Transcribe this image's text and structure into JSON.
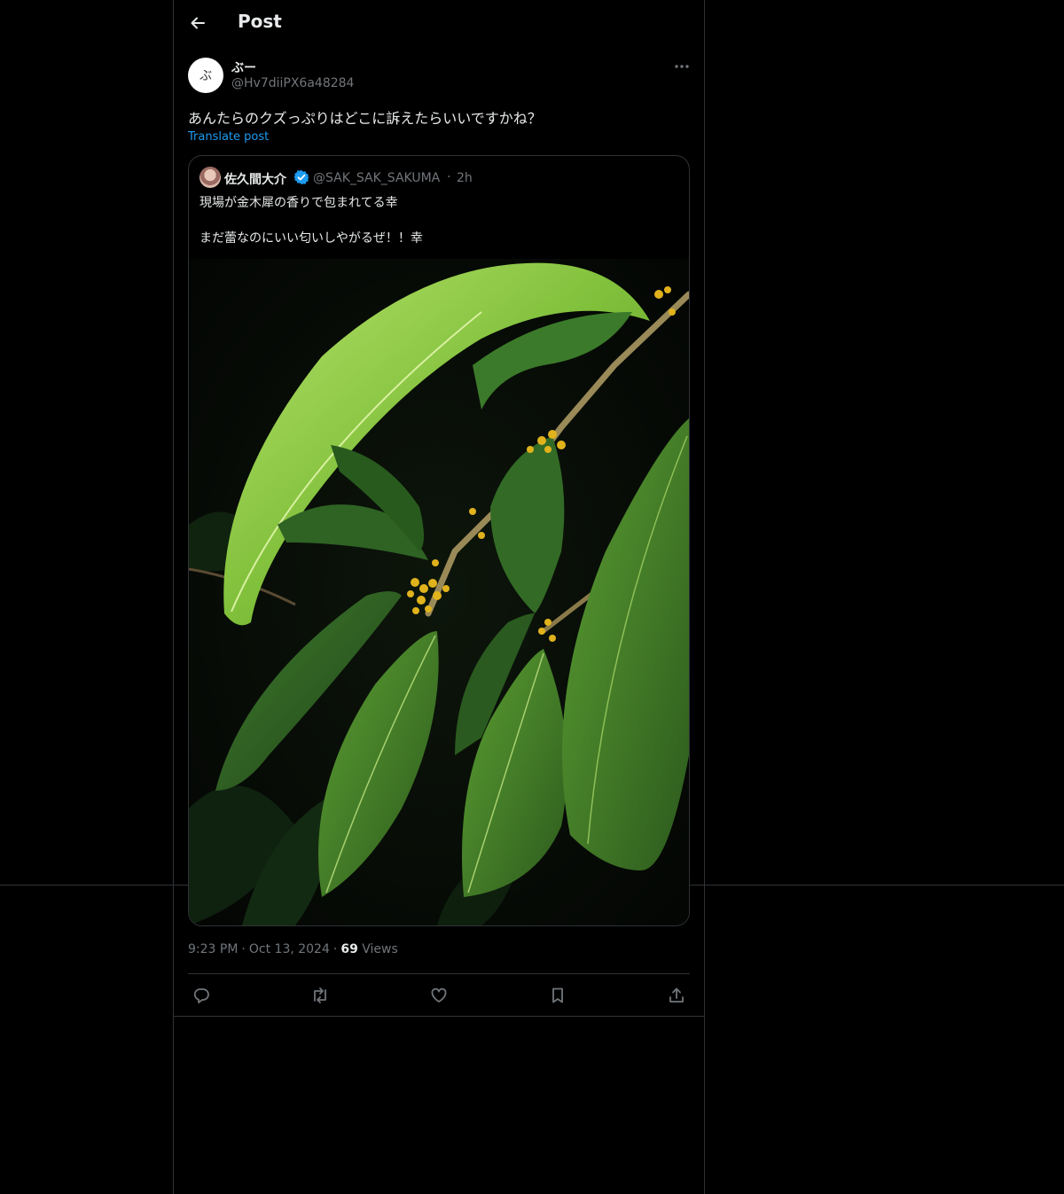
{
  "header": {
    "title": "Post"
  },
  "post": {
    "author_name": "ぶー",
    "author_handle": "@Hv7diiPX6a48284",
    "avatar_text": "ぶ",
    "text": "あんたらのクズっぷりはどこに訴えたらいいですかね？",
    "translate_label": "Translate post",
    "time": "9:23 PM",
    "date": "Oct 13, 2024",
    "views_count": "69",
    "views_label": "Views",
    "separator": "·"
  },
  "quote": {
    "author_name": "佐久間大介",
    "author_handle": "@SAK_SAK_SAKUMA",
    "separator": "·",
    "time_ago": "2h",
    "line1": "現場が金木犀の香りで包まれてる幸",
    "line2": "まだ蕾なのにいい匂いしやがるぜ！！幸"
  },
  "icons": {
    "back": "back-arrow-icon",
    "more": "more-icon",
    "verified": "verified-badge-icon",
    "reply": "reply-icon",
    "repost": "repost-icon",
    "like": "like-icon",
    "bookmark": "bookmark-icon",
    "share": "share-icon"
  },
  "colors": {
    "background": "#000000",
    "text": "#e7e9ea",
    "secondary": "#71767b",
    "link": "#1d9bf0",
    "border": "#2f3336"
  }
}
